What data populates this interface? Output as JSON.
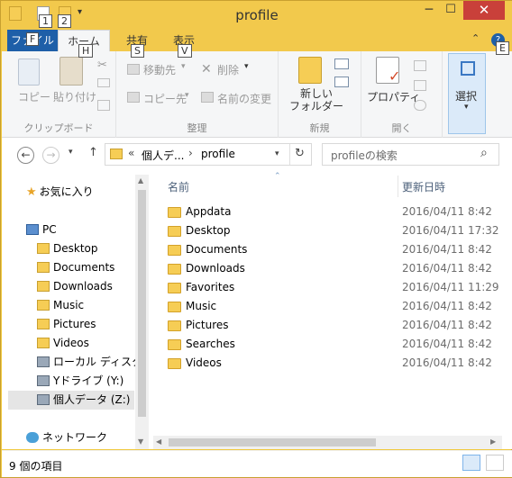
{
  "window": {
    "title": "profile"
  },
  "qat": {
    "keytip1": "1",
    "keytip2": "2"
  },
  "controls": {
    "minimize": "─",
    "maximize": "☐",
    "close": "✕"
  },
  "tabs": [
    {
      "label": "ファイル",
      "keytip": "F"
    },
    {
      "label": "ホーム",
      "keytip": "H"
    },
    {
      "label": "共有",
      "keytip": "S"
    },
    {
      "label": "表示",
      "keytip": "V"
    }
  ],
  "help_keytip": "E",
  "ribbon": {
    "clipboard": {
      "label": "クリップボード",
      "copy": "コピー",
      "paste": "貼り付け"
    },
    "organize": {
      "label": "整理",
      "move_to": "移動先",
      "copy_to": "コピー先",
      "delete": "削除",
      "rename": "名前の変更"
    },
    "new": {
      "label": "新規",
      "new_folder": "新しい\nフォルダー"
    },
    "open": {
      "label": "開く",
      "properties": "プロパティ"
    },
    "select": {
      "label": "選択"
    }
  },
  "address": {
    "prefix": "«",
    "crumb1": "個人デ...",
    "sep": "›",
    "crumb2": "profile",
    "search_placeholder": "profileの検索"
  },
  "nav": {
    "favorites": "お気に入り",
    "pc": "PC",
    "items": [
      {
        "label": "Desktop"
      },
      {
        "label": "Documents"
      },
      {
        "label": "Downloads"
      },
      {
        "label": "Music"
      },
      {
        "label": "Pictures"
      },
      {
        "label": "Videos"
      },
      {
        "label": "ローカル ディスク (C"
      },
      {
        "label": "Yドライブ (Y:)"
      },
      {
        "label": "個人データ (Z:)"
      }
    ],
    "network": "ネットワーク"
  },
  "columns": {
    "name": "名前",
    "date": "更新日時"
  },
  "files": [
    {
      "name": "Appdata",
      "date": "2016/04/11 8:42"
    },
    {
      "name": "Desktop",
      "date": "2016/04/11 17:32"
    },
    {
      "name": "Documents",
      "date": "2016/04/11 8:42"
    },
    {
      "name": "Downloads",
      "date": "2016/04/11 8:42"
    },
    {
      "name": "Favorites",
      "date": "2016/04/11 11:29"
    },
    {
      "name": "Music",
      "date": "2016/04/11 8:42"
    },
    {
      "name": "Pictures",
      "date": "2016/04/11 8:42"
    },
    {
      "name": "Searches",
      "date": "2016/04/11 8:42"
    },
    {
      "name": "Videos",
      "date": "2016/04/11 8:42"
    }
  ],
  "status": {
    "count": "9 個の項目"
  }
}
